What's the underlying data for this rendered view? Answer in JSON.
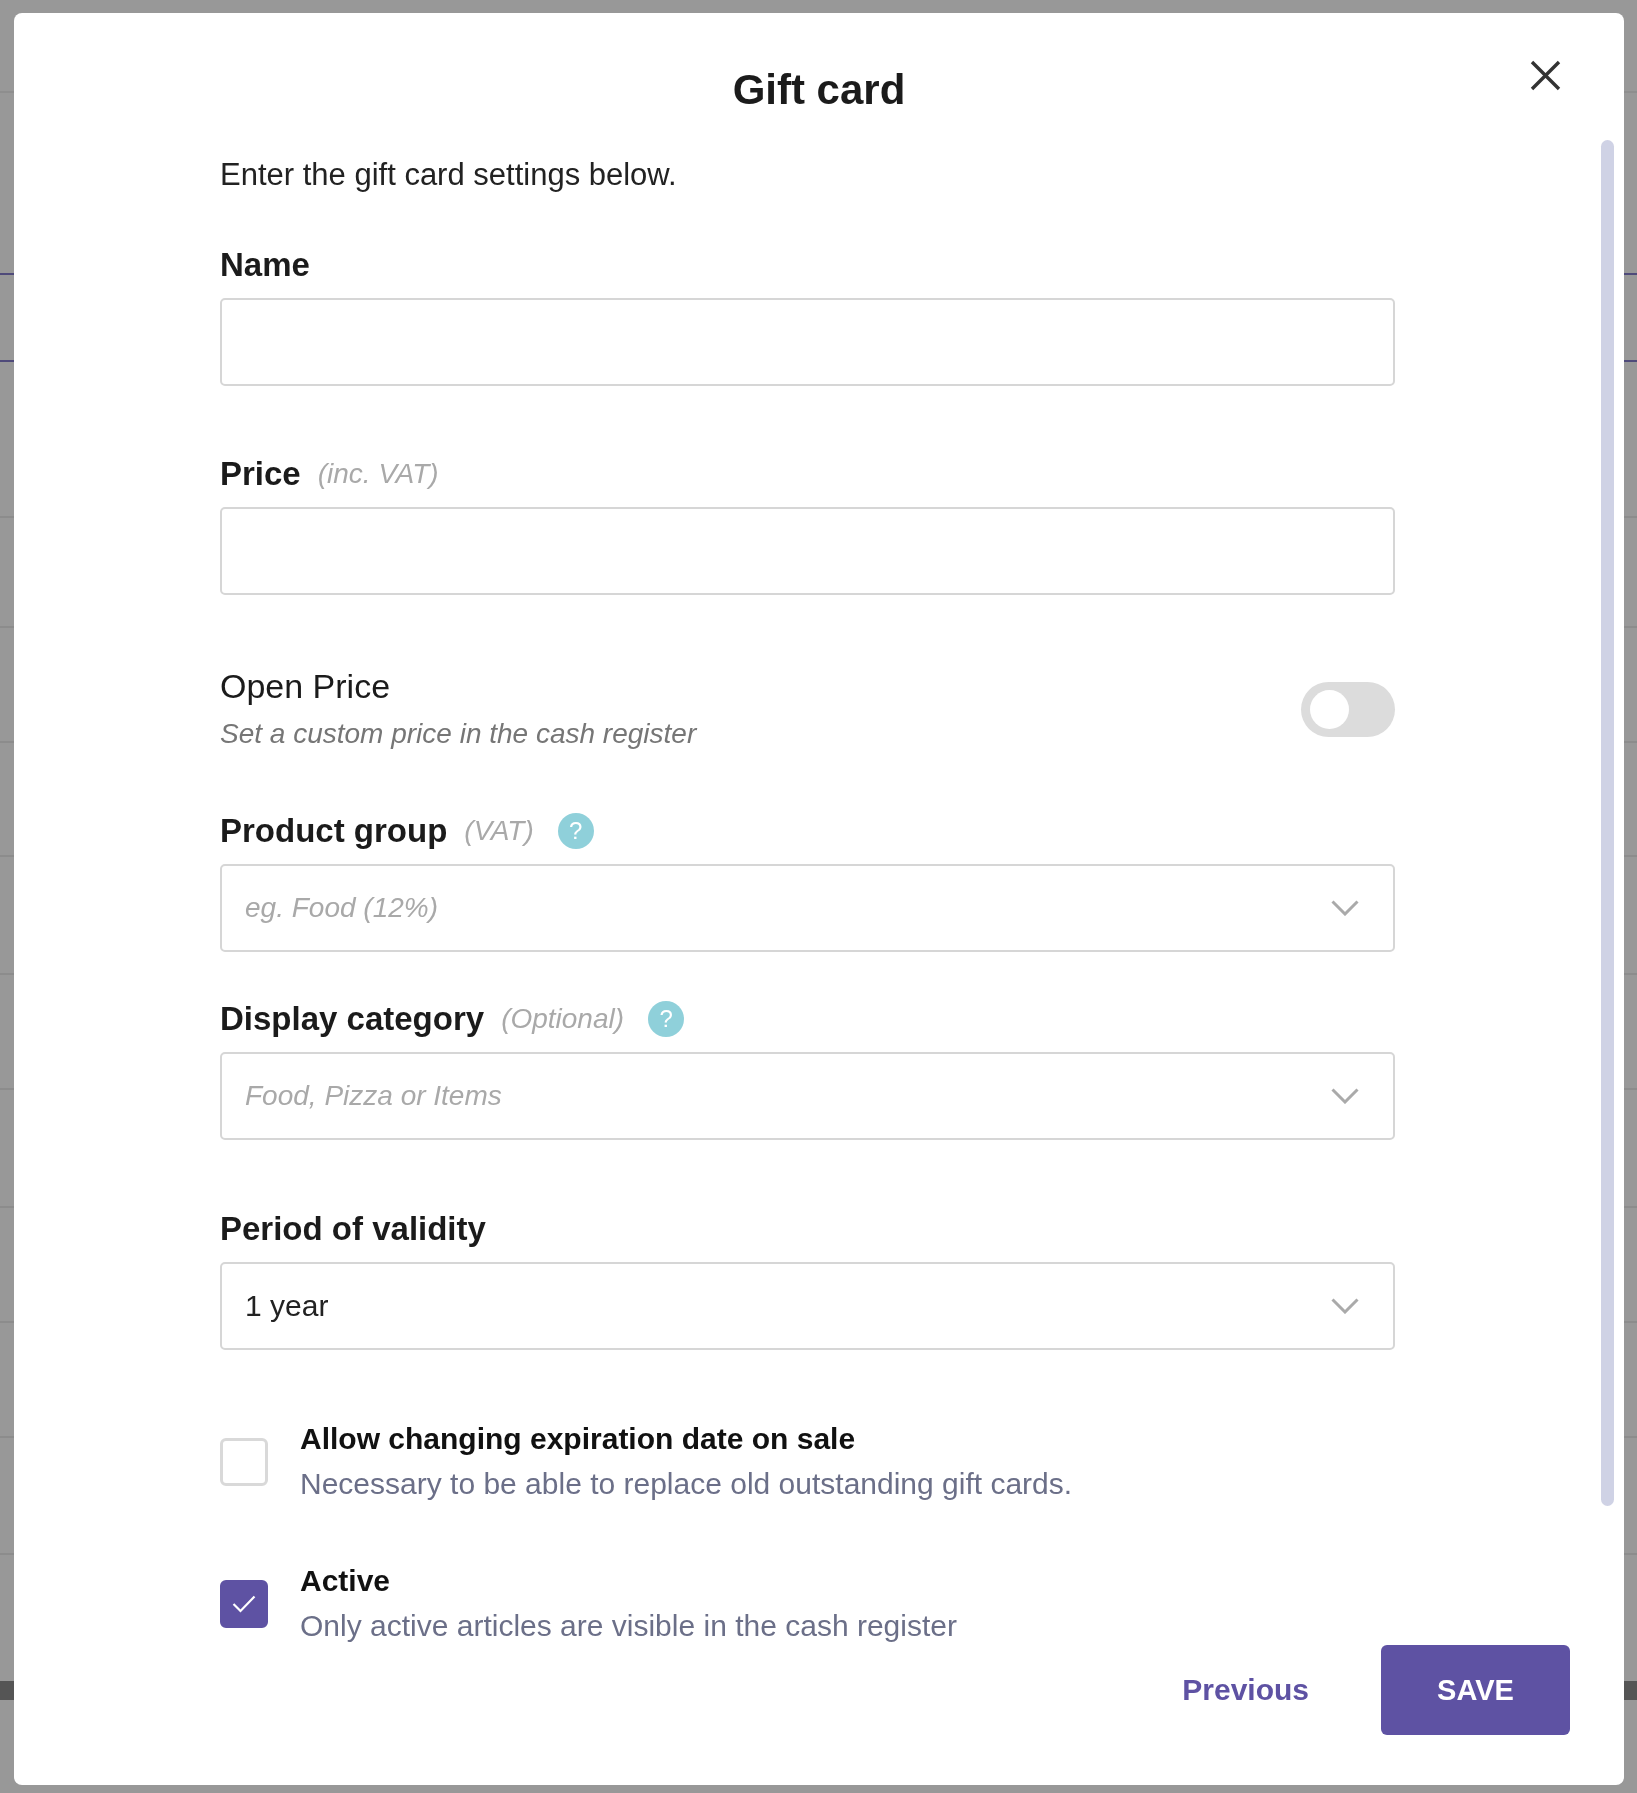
{
  "dialog": {
    "title": "Gift card",
    "intro": "Enter the gift card settings below."
  },
  "fields": [
    {
      "kind": "text",
      "label": "Name"
    },
    {
      "kind": "text",
      "label": "Price",
      "hint": "(inc. VAT)"
    },
    {
      "kind": "toggle",
      "label": "Open Price",
      "description": "Set a custom price in the cash register",
      "on": false
    },
    {
      "kind": "select",
      "label": "Product group",
      "hint": "(VAT)",
      "help": "?",
      "placeholder": "eg. Food (12%)"
    },
    {
      "kind": "select",
      "label": "Display category",
      "hint": "(Optional)",
      "help": "?",
      "placeholder": "Food, Pizza or Items"
    },
    {
      "kind": "select",
      "label": "Period of validity",
      "value": "1 year"
    },
    {
      "kind": "checkbox",
      "label": "Allow changing expiration date on sale",
      "description": "Necessary to be able to replace old outstanding gift cards.",
      "checked": false
    },
    {
      "kind": "checkbox",
      "label": "Active",
      "description": "Only active articles are visible in the cash register",
      "checked": true
    }
  ],
  "footer": {
    "buttons": [
      {
        "kind": "link",
        "label": "Previous"
      },
      {
        "kind": "primary",
        "label": "SAVE"
      }
    ]
  }
}
